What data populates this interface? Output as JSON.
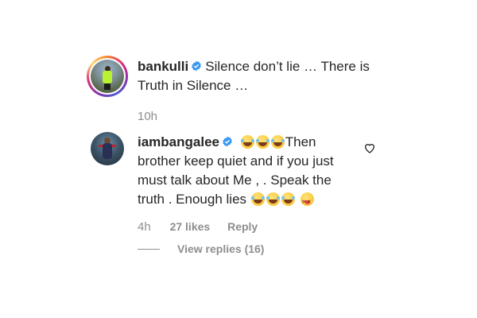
{
  "caption": {
    "username": "bankulli",
    "text_line1": "Silence don’t lie … There is",
    "text_line2": "Truth in Silence …",
    "time": "10h"
  },
  "comment": {
    "username": "iambangalee",
    "text_line1_end": "Then",
    "text_line2": "brother keep quiet and if you just",
    "text_line3": "must talk about Me , . Speak the",
    "text_line4": "truth . Enough lies",
    "emojis_start": [
      "face-with-tears-of-joy",
      "face-with-tears-of-joy",
      "face-with-tears-of-joy"
    ],
    "emojis_end": [
      "face-with-tears-of-joy",
      "face-with-tears-of-joy",
      "face-with-tears-of-joy",
      "squinting-face-with-tongue"
    ],
    "time": "4h",
    "likes": "27 likes",
    "reply_label": "Reply",
    "view_replies": "View replies (16)"
  },
  "colors": {
    "verified_badge": "#3897f0",
    "muted_text": "#8e8e8e",
    "primary_text": "#262626"
  }
}
